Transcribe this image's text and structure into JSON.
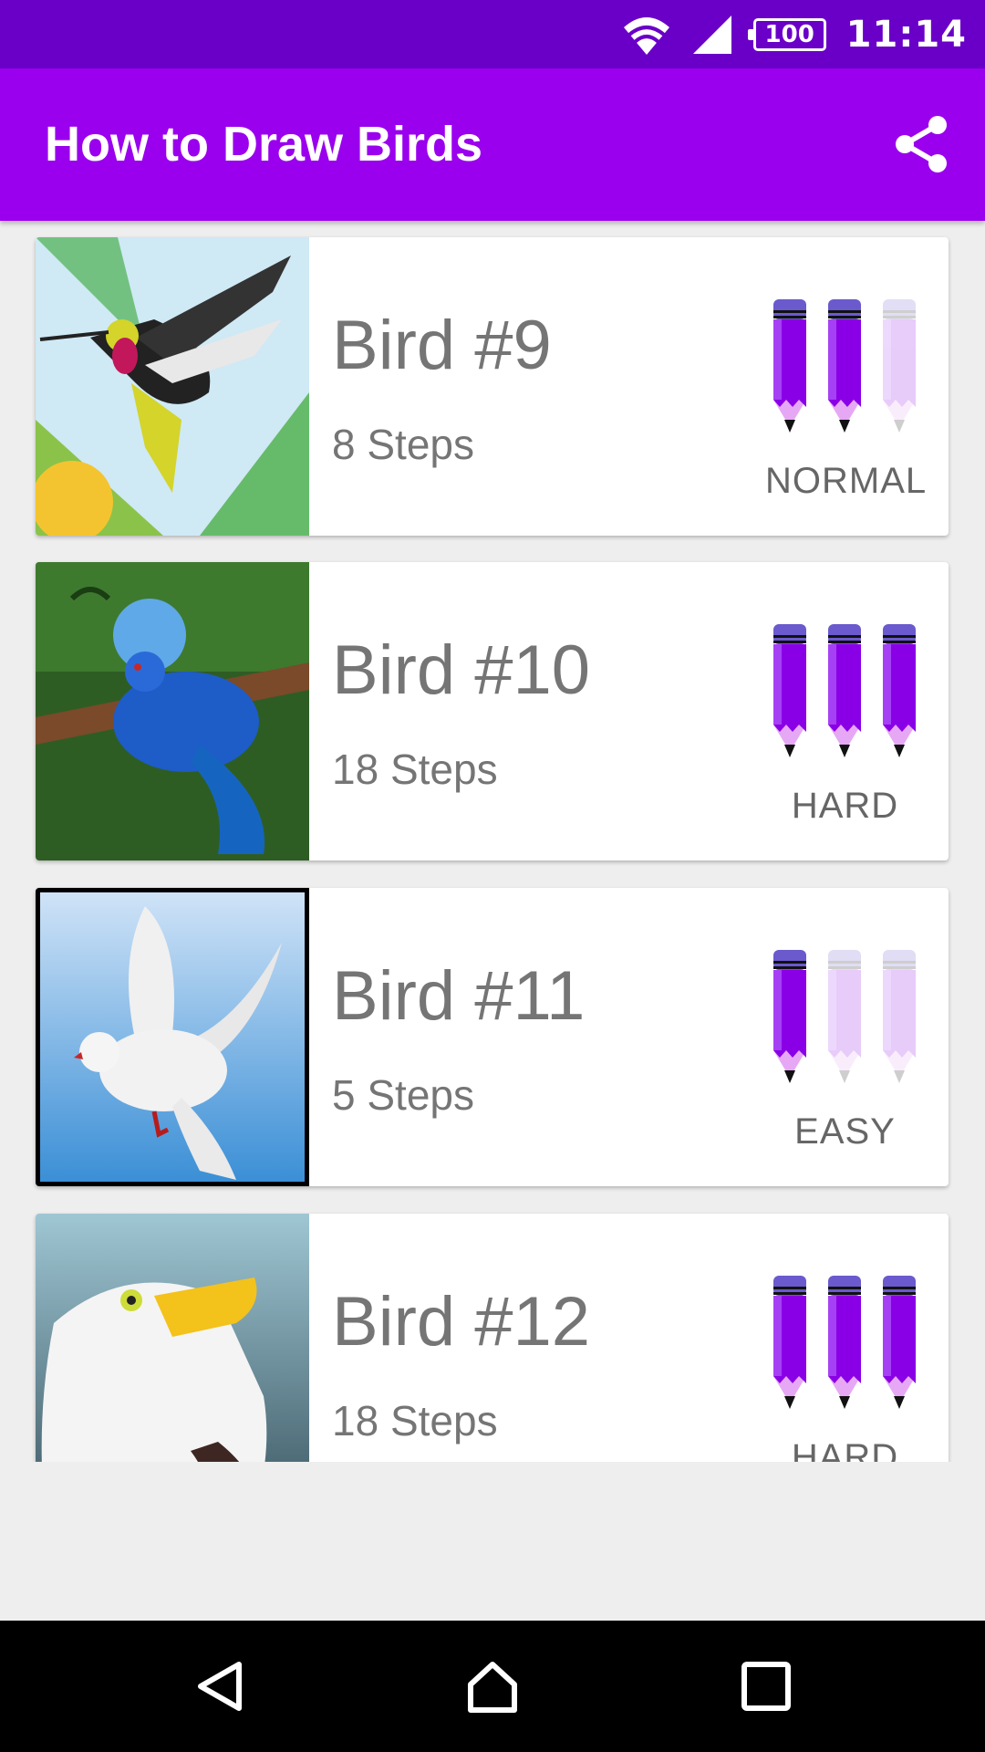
{
  "status_bar": {
    "battery": "100",
    "time": "11:14"
  },
  "app": {
    "title": "How to Draw Birds",
    "share_icon": "share-icon"
  },
  "cards": [
    {
      "title": "Bird #9",
      "steps": "8 Steps",
      "difficulty": "NORMAL",
      "level": 2,
      "max_level": 3
    },
    {
      "title": "Bird #10",
      "steps": "18 Steps",
      "difficulty": "HARD",
      "level": 3,
      "max_level": 3
    },
    {
      "title": "Bird #11",
      "steps": "5 Steps",
      "difficulty": "EASY",
      "level": 1,
      "max_level": 3
    },
    {
      "title": "Bird #12",
      "steps": "18 Steps",
      "difficulty": "HARD",
      "level": 3,
      "max_level": 3
    }
  ],
  "nav": {
    "back": "back-icon",
    "home": "home-icon",
    "recents": "recents-icon"
  },
  "colors": {
    "status_bar": "#6a00c8",
    "app_bar": "#9a00ee",
    "pencil": "#8a00e6"
  }
}
